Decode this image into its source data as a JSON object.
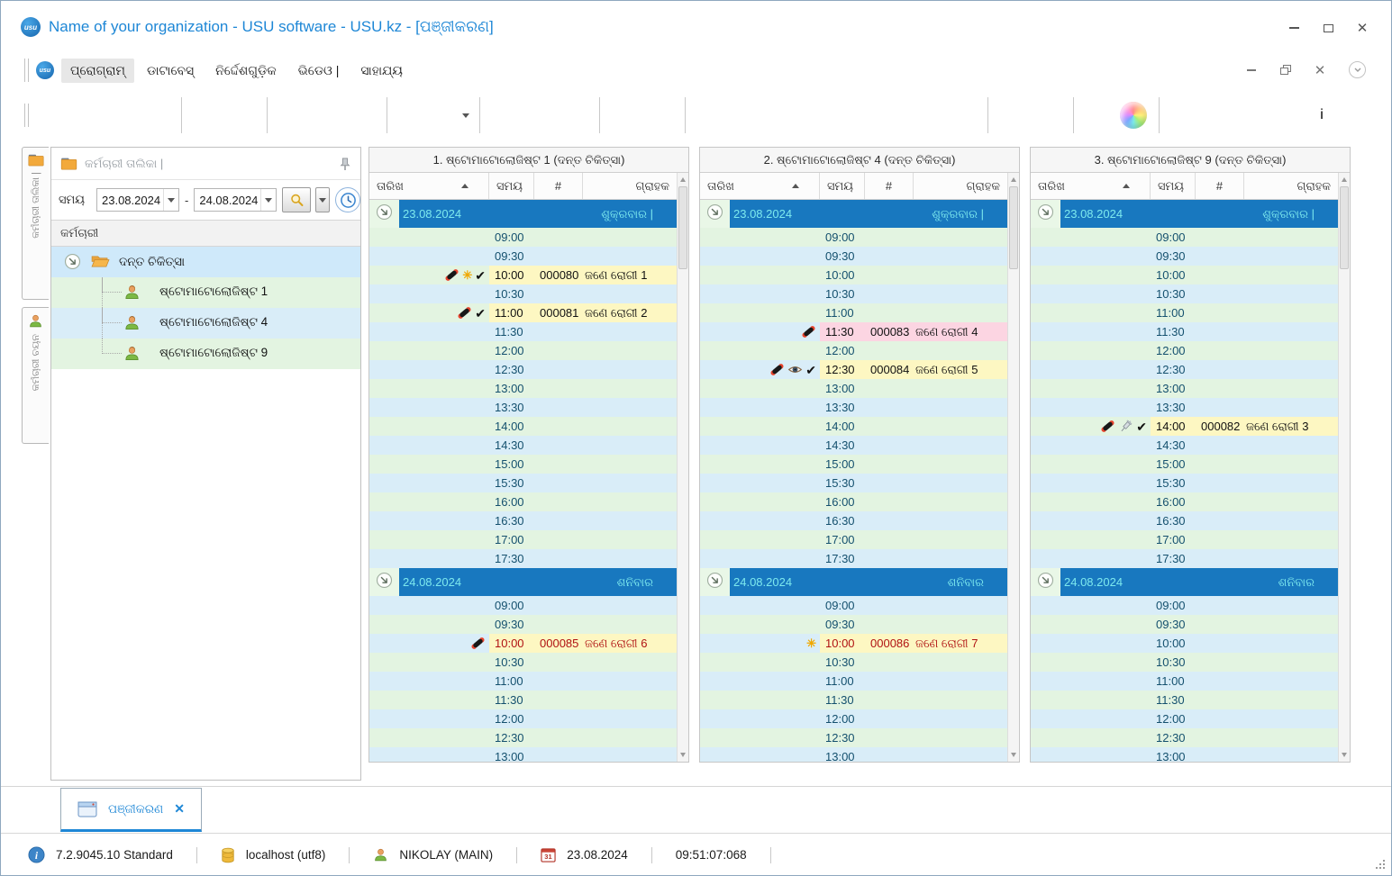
{
  "window": {
    "title": "Name of your organization - USU software - USU.kz - [ପଞ୍ଜୀକରଣ]"
  },
  "menu": {
    "items": [
      "ପ୍ରୋଗ୍ରାମ୍",
      "ଡାଟାବେସ୍",
      "ନିର୍ଦ୍ଦେଶଗୁଡ଼ିକ",
      "ଭିଡେଓ |",
      "ସାହାଯ୍ୟ"
    ]
  },
  "toolbar": {
    "buttons": [
      "new-document",
      "copy",
      "edit",
      "delete",
      "refresh",
      "search",
      "filter",
      "filter-columns",
      "filter-check",
      "flag",
      "image",
      "row-size",
      "collapse-all",
      "expand-all",
      "add-column",
      "report",
      "import",
      "more",
      "location-pin",
      "calendar",
      "settings",
      "color-theme",
      "lock",
      "user-rights",
      "user-groups",
      "plugin",
      "info",
      "more"
    ]
  },
  "sidebar": {
    "tabs": [
      {
        "label": "କର୍ମଚାରୀ ତାଲିକା |",
        "icon": "folder-icon"
      },
      {
        "label": "କର୍ମଚାରୀ ଚୟନ",
        "icon": "user-icon"
      }
    ],
    "panel_title": "କର୍ମଚାରୀ ତାଲିକା |",
    "time_label": "ସମୟ",
    "date_from": "23.08.2024",
    "date_to": "24.08.2024",
    "date_separator": "-",
    "column_header": "କର୍ମଚାରୀ",
    "tree": {
      "root": "ଦନ୍ତ ଚିକିତ୍ସା",
      "children": [
        "ଷ୍ଟୋମାଟୋଲୋଜିଷ୍ଟ 1",
        "ଷ୍ଟୋମାଟୋଲୋଜିଷ୍ଟ 4",
        "ଷ୍ଟୋମାଟୋଲୋଜିଷ୍ଟ 9"
      ]
    }
  },
  "schedule": {
    "columns": {
      "date": "ତାରିଖ",
      "time": "ସମୟ",
      "number": "#",
      "client": "ଗ୍ରାହକ"
    },
    "day1_times": [
      "09:00",
      "09:30",
      "10:00",
      "10:30",
      "11:00",
      "11:30",
      "12:00",
      "12:30",
      "13:00",
      "13:30",
      "14:00",
      "14:30",
      "15:00",
      "15:30",
      "16:00",
      "16:30",
      "17:00",
      "17:30"
    ],
    "day2_times": [
      "09:00",
      "09:30",
      "10:00",
      "10:30",
      "11:00",
      "11:30",
      "12:00",
      "12:30",
      "13:00"
    ],
    "panels": [
      {
        "title": "1. ଷ୍ଟୋମାଟୋଲୋଜିଷ୍ଟ 1 (ଦନ୍ତ ଚିକିତ୍ସା)",
        "groups": [
          {
            "date": "23.08.2024",
            "day": "ଶୁକ୍ରବାର |",
            "times": "day1_times",
            "appointments": {
              "10:00": {
                "number": "000080",
                "client": "ଜଣେ ରୋଗୀ 1",
                "icons": [
                  "phone",
                  "star",
                  "check"
                ],
                "highlight": "yellow",
                "urgent": false
              },
              "11:00": {
                "number": "000081",
                "client": "ଜଣେ ରୋଗୀ 2",
                "icons": [
                  "phone",
                  "check"
                ],
                "highlight": "yellow",
                "urgent": false
              }
            }
          },
          {
            "date": "24.08.2024",
            "day": "ଶନିବାର",
            "times": "day2_times",
            "appointments": {
              "10:00": {
                "number": "000085",
                "client": "ଜଣେ ରୋଗୀ 6",
                "icons": [
                  "phone"
                ],
                "highlight": "yellow",
                "urgent": true
              }
            }
          }
        ]
      },
      {
        "title": "2. ଷ୍ଟୋମାଟୋଲୋଜିଷ୍ଟ 4 (ଦନ୍ତ ଚିକିତ୍ସା)",
        "groups": [
          {
            "date": "23.08.2024",
            "day": "ଶୁକ୍ରବାର |",
            "times": "day1_times",
            "appointments": {
              "11:30": {
                "number": "000083",
                "client": "ଜଣେ ରୋଗୀ 4",
                "icons": [
                  "phone"
                ],
                "highlight": "pink",
                "urgent": false
              },
              "12:30": {
                "number": "000084",
                "client": "ଜଣେ ରୋଗୀ 5",
                "icons": [
                  "phone",
                  "eye",
                  "check"
                ],
                "highlight": "yellow",
                "urgent": false
              }
            }
          },
          {
            "date": "24.08.2024",
            "day": "ଶନିବାର",
            "times": "day2_times",
            "appointments": {
              "10:00": {
                "number": "000086",
                "client": "ଜଣେ ରୋଗୀ 7",
                "icons": [
                  "star"
                ],
                "highlight": "yellow",
                "urgent": true
              }
            }
          }
        ]
      },
      {
        "title": "3. ଷ୍ଟୋମାଟୋଲୋଜିଷ୍ଟ 9 (ଦନ୍ତ ଚିକିତ୍ସା)",
        "groups": [
          {
            "date": "23.08.2024",
            "day": "ଶୁକ୍ରବାର |",
            "times": "day1_times",
            "appointments": {
              "14:00": {
                "number": "000082",
                "client": "ଜଣେ ରୋଗୀ 3",
                "icons": [
                  "phone",
                  "syringe",
                  "check"
                ],
                "highlight": "yellow",
                "urgent": false
              }
            }
          },
          {
            "date": "24.08.2024",
            "day": "ଶନିବାର",
            "times": "day2_times",
            "appointments": {}
          }
        ]
      }
    ]
  },
  "bottom_tab": {
    "label": "ପଞ୍ଜୀକରଣ"
  },
  "statusbar": {
    "version": "7.2.9045.10 Standard",
    "database": "localhost (utf8)",
    "user": "NIKOLAY (MAIN)",
    "date": "23.08.2024",
    "time": "09:51:07:068"
  },
  "colors": {
    "accent": "#1e87d6",
    "group_row": "#1878bf",
    "group_text": "#7de9ee",
    "slot_yellow": "#fdf7c2",
    "slot_pink": "#fcd5e2",
    "row_blue": "#d9edf8",
    "row_green": "#e3f4e1",
    "urgent_text": "#b01212"
  }
}
